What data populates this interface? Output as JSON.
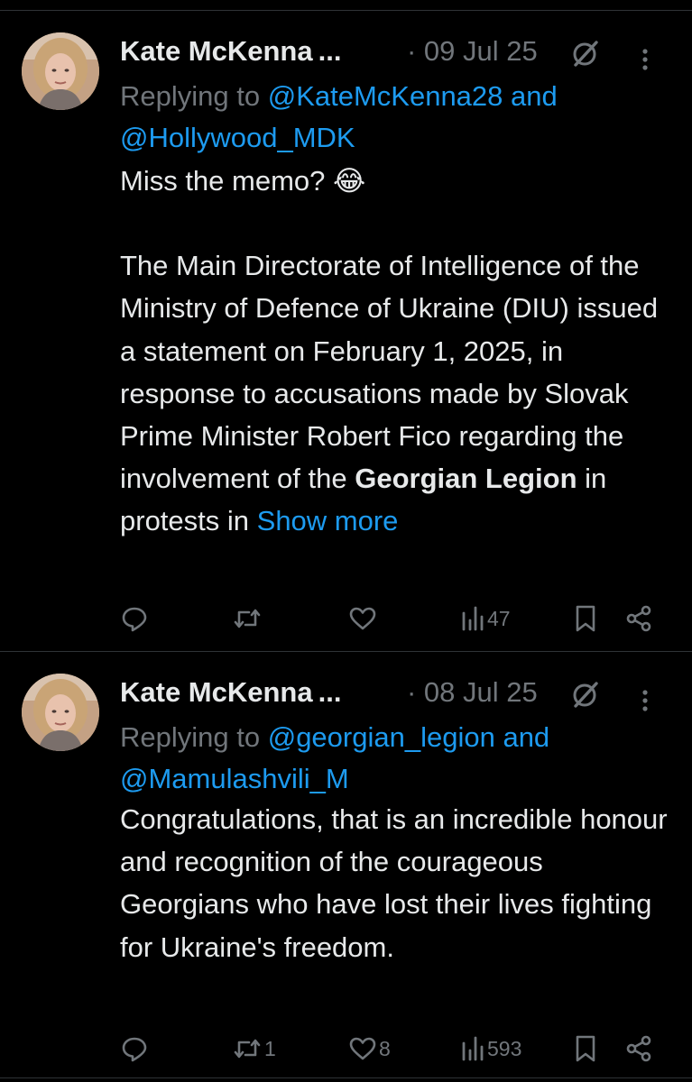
{
  "theme": {
    "background": "#000000",
    "text": "#e7e9ea",
    "muted": "#71767b",
    "link": "#1d9bf0",
    "divider": "#2f3336"
  },
  "tweets": [
    {
      "author": "Kate McKenna",
      "ellipsis": "...",
      "date_text": "· 09 Jul 25",
      "reply_prefix": "Replying to",
      "reply_mention_1": "@KateMcKenna28",
      "reply_and": "and",
      "reply_mention_2": "@Hollywood_MDK",
      "line_1": "Miss the memo?",
      "emoji": "😂",
      "para_before_bold": "The Main Directorate of Intelligence of the Ministry of Defence of Ukraine (DIU) issued a statement on February 1, 2025, in response to accusations made by Slovak Prime Minister Robert Fico regarding the involvement of the",
      "bold_text": "Georgian Legion",
      "para_after_bold": "in protests in",
      "show_more": "Show more",
      "icons": {
        "reply": "reply-icon",
        "repost": "repost-icon",
        "like": "heart-icon",
        "views": "views-icon",
        "bookmark": "bookmark-icon",
        "share": "share-icon",
        "grok": "grok-icon",
        "more": "more-options-icon"
      },
      "reply_count": "",
      "repost_count": "",
      "like_count": "",
      "views_count": "47"
    },
    {
      "author": "Kate McKenna",
      "ellipsis": "...",
      "date_text": "· 08 Jul 25",
      "reply_prefix": "Replying to",
      "reply_mention_1": "@georgian_legion",
      "reply_and": "and",
      "reply_mention_2": "@Mamulashvili_M",
      "text": "Congratulations, that is an incredible honour and recognition of the courageous Georgians who have lost their lives fighting for Ukraine's freedom.",
      "reply_count": "",
      "repost_count": "1",
      "like_count": "8",
      "views_count": "593"
    }
  ]
}
